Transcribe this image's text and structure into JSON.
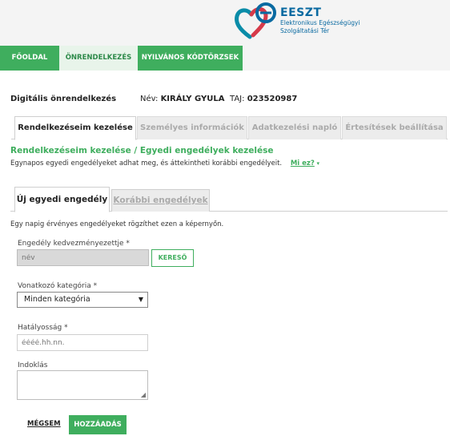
{
  "brand": {
    "title": "EESZT",
    "subtitle_line1": "Elektronikus Egészségügyi",
    "subtitle_line2": "Szolgáltatási Tér",
    "logo_icon": "eeszt-heart-logo-icon"
  },
  "nav": {
    "items": [
      {
        "label": "FŐOLDAL"
      },
      {
        "label": "ÖNRENDELKEZÉS"
      },
      {
        "label": "NYILVÁNOS KÓDTÖRZSEK"
      }
    ]
  },
  "page": {
    "title": "Digitális önrendelkezés",
    "name_label": "Név:",
    "name_value": "KIRÁLY GYULA",
    "taj_label": "TAJ:",
    "taj_value": "023520987"
  },
  "tabs": [
    {
      "label": "Rendelkezéseim kezelése"
    },
    {
      "label": "Személyes információk"
    },
    {
      "label": "Adatkezelési napló"
    },
    {
      "label": "Értesítések beállítása"
    }
  ],
  "section": {
    "title": "Rendelkezéseim kezelése / Egyedi engedélyek kezelése",
    "description": "Egynapos egyedi engedélyeket adhat meg, és áttekintheti korábbi engedélyeit.",
    "help_link": "Mi ez?",
    "help_caret": "▾"
  },
  "sub_tabs": [
    {
      "label": "Új egyedi engedély"
    },
    {
      "label": "Korábbi engedélyek"
    }
  ],
  "form": {
    "info": "Egy napig érvényes engedélyeket rögzíthet ezen a képernyőn.",
    "beneficiary_label": "Engedély kedvezményezettje *",
    "beneficiary_placeholder": "név",
    "search_button": "KERESŐ",
    "category_label": "Vonatkozó kategória *",
    "category_value": "Minden kategória",
    "category_arrow": "▼",
    "validity_label": "Hatályosság *",
    "validity_placeholder": "éééé.hh.nn.",
    "reason_label": "Indoklás",
    "cancel_button": "MÉGSEM",
    "add_button": "HOZZÁADÁS"
  },
  "colors": {
    "accent": "#3fae5e",
    "brand_blue": "#0a6aa1",
    "brand_red": "#d63a4a"
  }
}
